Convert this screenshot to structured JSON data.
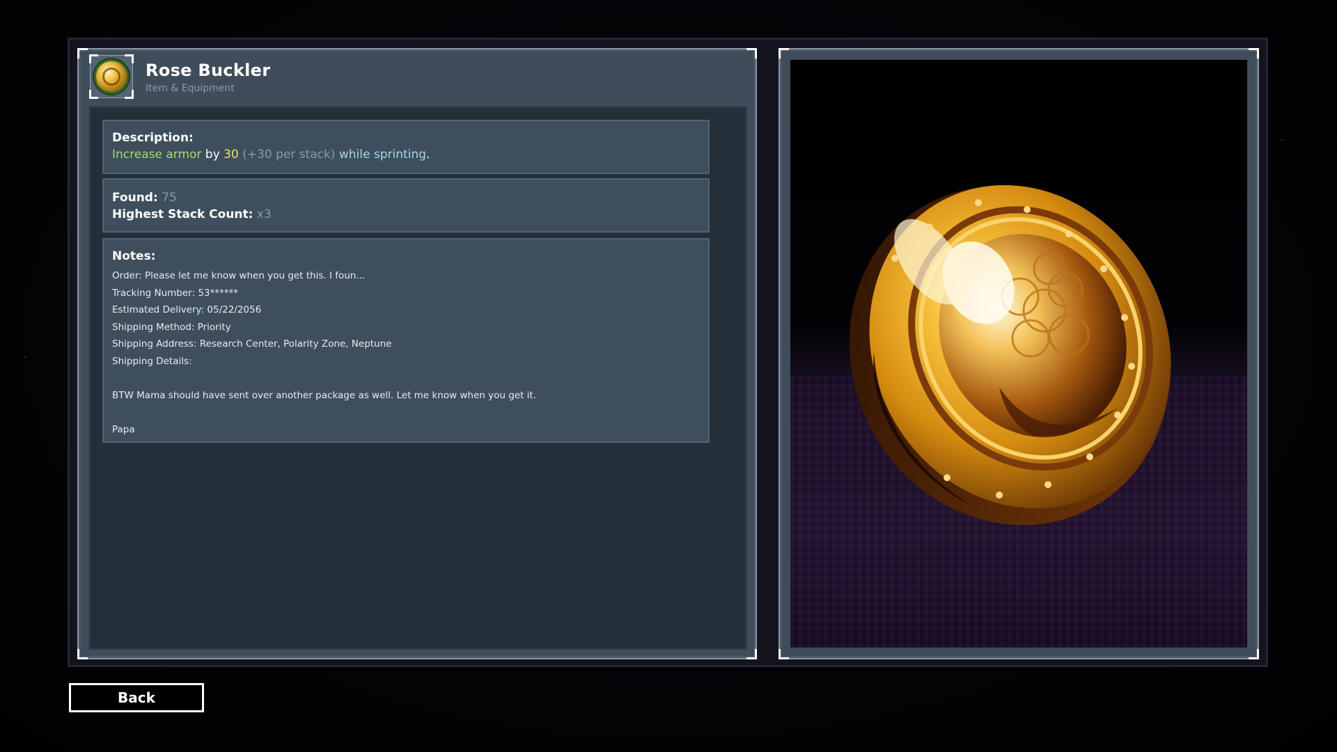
{
  "item": {
    "name": "Rose Buckler",
    "category": "Item & Equipment",
    "icon": "shield-icon"
  },
  "description": {
    "label": "Description:",
    "part1": "Increase armor",
    "part2": " by ",
    "part3": "30",
    "part4": " (+30 per stack)",
    "part5": " while sprinting",
    "part6": "."
  },
  "stats": {
    "found_label": "Found:",
    "found_value": "75",
    "stack_label": "Highest Stack Count:",
    "stack_value": "x3"
  },
  "notes": {
    "label": "Notes:",
    "lines": [
      "Order: Please let me know when you get this. I foun...",
      "Tracking Number: 53******",
      "Estimated Delivery: 05/22/2056",
      "Shipping Method: Priority",
      "Shipping Address: Research Center, Polarity Zone, Neptune",
      "Shipping Details:",
      "",
      "BTW Mama should have sent over another package as well. Let me know when you get it.",
      "",
      "Papa"
    ]
  },
  "buttons": {
    "back": "Back"
  },
  "colors": {
    "highlight_green": "#9fe06e",
    "highlight_yellow": "#e3e75a",
    "highlight_blue": "#a7d4ec",
    "muted_grey": "#8e99a4",
    "panel_bg": "#3f4d5b"
  }
}
